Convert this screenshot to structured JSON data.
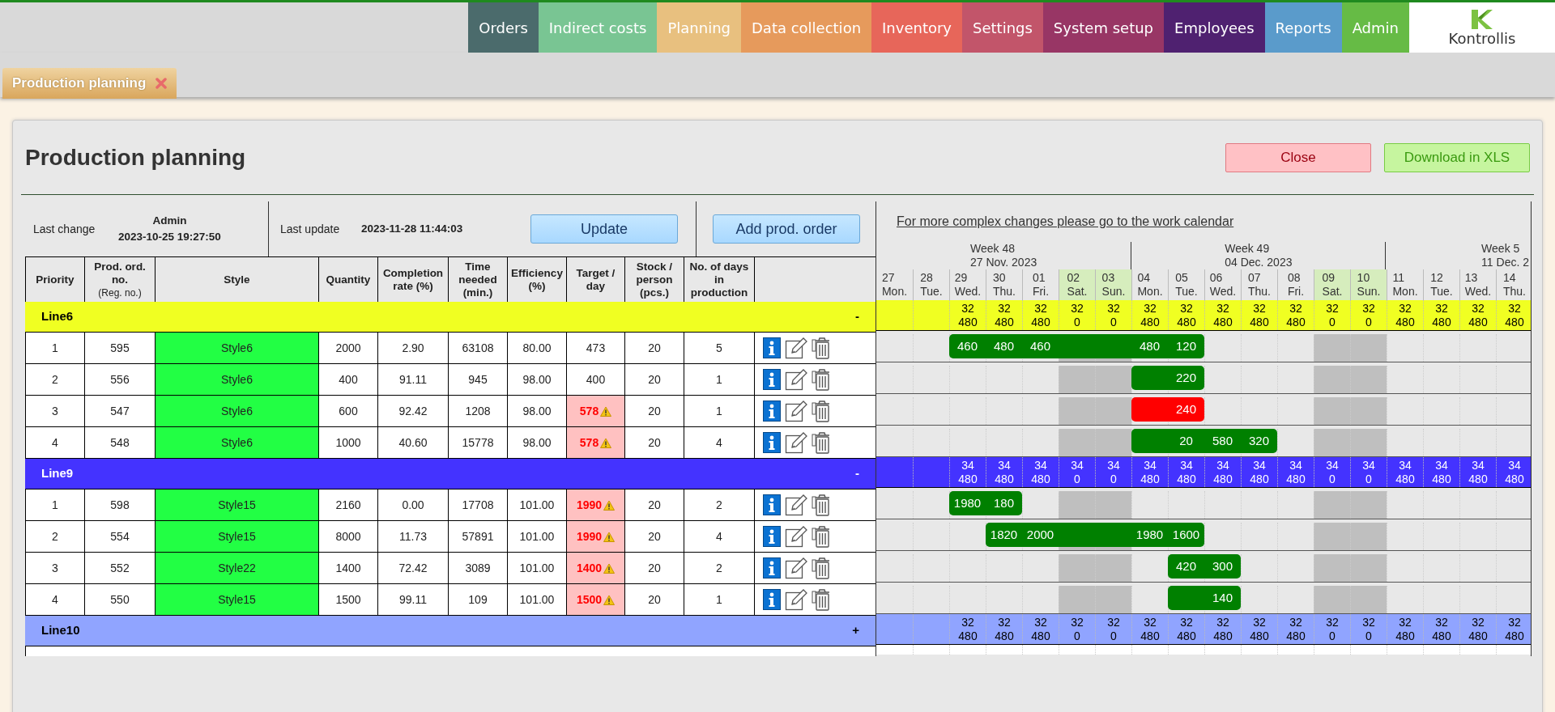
{
  "nav": [
    {
      "label": "Orders",
      "color": "#4b6b6c"
    },
    {
      "label": "Indirect costs",
      "color": "#79c593"
    },
    {
      "label": "Planning",
      "color": "#e8c07f"
    },
    {
      "label": "Data collection",
      "color": "#e69a5c"
    },
    {
      "label": "Inventory",
      "color": "#e7665a"
    },
    {
      "label": "Settings",
      "color": "#c2556a"
    },
    {
      "label": "System setup",
      "color": "#983665"
    },
    {
      "label": "Employees",
      "color": "#4f2170"
    },
    {
      "label": "Reports",
      "color": "#5a9bcb"
    },
    {
      "label": "Admin",
      "color": "#66bb45"
    }
  ],
  "logo": {
    "text": "Kontrollis"
  },
  "tabs": [
    {
      "label": "Production planning",
      "selected": true
    }
  ],
  "title": "Production planning",
  "buttons": [
    {
      "label": "Close",
      "kind": "danger"
    },
    {
      "label": "Download in XLS",
      "kind": "success"
    }
  ],
  "info": {
    "last_change_label": "Last change",
    "last_change_user": "Admin",
    "last_change_time": "2023-10-25 19:27:50",
    "last_update_label": "Last update",
    "last_update_time": "2023-11-28 11:44:03",
    "update_button": "Update",
    "add_button": "Add prod. order"
  },
  "calendar_link": "For more complex changes please go to the work calendar",
  "columns": [
    {
      "label": "Priority"
    },
    {
      "label": "Prod. ord. no.",
      "sub": "(Reg. no.)"
    },
    {
      "label": "Style"
    },
    {
      "label": "Quantity"
    },
    {
      "label": "Completion rate (%)"
    },
    {
      "label": "Time needed (min.)"
    },
    {
      "label": "Efficiency (%)"
    },
    {
      "label": "Target / day"
    },
    {
      "label": "Stock / person (pcs.)"
    },
    {
      "label": "No. of days in production"
    }
  ],
  "weeks": [
    {
      "label": "Week 48",
      "date": "27 Nov. 2023",
      "days": [
        {
          "num": "27",
          "name": "Mon.",
          "weekend": false
        },
        {
          "num": "28",
          "name": "Tue.",
          "weekend": false
        },
        {
          "num": "29",
          "name": "Wed.",
          "weekend": false
        },
        {
          "num": "30",
          "name": "Thu.",
          "weekend": false
        },
        {
          "num": "01",
          "name": "Fri.",
          "weekend": false
        },
        {
          "num": "02",
          "name": "Sat.",
          "weekend": true
        },
        {
          "num": "03",
          "name": "Sun.",
          "weekend": true
        }
      ]
    },
    {
      "label": "Week 49",
      "date": "04 Dec. 2023",
      "days": [
        {
          "num": "04",
          "name": "Mon.",
          "weekend": false
        },
        {
          "num": "05",
          "name": "Tue.",
          "weekend": false
        },
        {
          "num": "06",
          "name": "Wed.",
          "weekend": false
        },
        {
          "num": "07",
          "name": "Thu.",
          "weekend": false
        },
        {
          "num": "08",
          "name": "Fri.",
          "weekend": false
        },
        {
          "num": "09",
          "name": "Sat.",
          "weekend": true
        },
        {
          "num": "10",
          "name": "Sun.",
          "weekend": true
        }
      ]
    },
    {
      "label": "Week 5",
      "date": "11 Dec. 2",
      "days": [
        {
          "num": "11",
          "name": "Mon.",
          "weekend": false
        },
        {
          "num": "12",
          "name": "Tue.",
          "weekend": false
        },
        {
          "num": "13",
          "name": "Wed.",
          "weekend": false
        },
        {
          "num": "14",
          "name": "Thu.",
          "weekend": false
        }
      ]
    }
  ],
  "lines": [
    {
      "name": "Line6",
      "color": "#f0ff22",
      "toggle": "-",
      "capacity": [
        {
          "kind": "empty"
        },
        {
          "kind": "empty"
        },
        {
          "kind": "value",
          "workers": "32",
          "minutes": "480"
        },
        {
          "kind": "value",
          "workers": "32",
          "minutes": "480"
        },
        {
          "kind": "value",
          "workers": "32",
          "minutes": "480"
        },
        {
          "kind": "value",
          "workers": "32",
          "minutes": "0"
        },
        {
          "kind": "value",
          "workers": "32",
          "minutes": "0"
        },
        {
          "kind": "value",
          "workers": "32",
          "minutes": "480"
        },
        {
          "kind": "value",
          "workers": "32",
          "minutes": "480"
        },
        {
          "kind": "value",
          "workers": "32",
          "minutes": "480"
        },
        {
          "kind": "value",
          "workers": "32",
          "minutes": "480"
        },
        {
          "kind": "value",
          "workers": "32",
          "minutes": "480"
        },
        {
          "kind": "value",
          "workers": "32",
          "minutes": "0"
        },
        {
          "kind": "value",
          "workers": "32",
          "minutes": "0"
        },
        {
          "kind": "value",
          "workers": "32",
          "minutes": "480"
        },
        {
          "kind": "value",
          "workers": "32",
          "minutes": "480"
        },
        {
          "kind": "value",
          "workers": "32",
          "minutes": "480"
        },
        {
          "kind": "value",
          "workers": "32",
          "minutes": "480"
        }
      ],
      "orders": [
        {
          "priority": "1",
          "order_no": "595",
          "style": "Style6",
          "quantity": "2000",
          "completion": "2.90",
          "time_needed": "63108",
          "efficiency": "80.00",
          "target": "473",
          "target_warning": false,
          "stock": "20",
          "days": "5",
          "color": "#008000",
          "slots": [
            {
              "kind": "free"
            },
            {
              "kind": "free"
            },
            {
              "kind": "bar",
              "text": "460"
            },
            {
              "kind": "bar",
              "text": "480"
            },
            {
              "kind": "bar",
              "text": "460"
            },
            {
              "kind": "bar"
            },
            {
              "kind": "bar"
            },
            {
              "kind": "bar",
              "text": "480"
            },
            {
              "kind": "bar",
              "text": "120"
            },
            {
              "kind": "free"
            },
            {
              "kind": "free"
            },
            {
              "kind": "free"
            },
            {
              "kind": "free"
            },
            {
              "kind": "free"
            },
            {
              "kind": "free"
            },
            {
              "kind": "free"
            },
            {
              "kind": "free"
            },
            {
              "kind": "free"
            }
          ]
        },
        {
          "priority": "2",
          "order_no": "556",
          "style": "Style6",
          "quantity": "400",
          "completion": "91.11",
          "time_needed": "945",
          "efficiency": "98.00",
          "target": "400",
          "target_warning": false,
          "stock": "20",
          "days": "1",
          "color": "#008000",
          "slots": [
            {
              "kind": "free"
            },
            {
              "kind": "free"
            },
            {
              "kind": "free"
            },
            {
              "kind": "free"
            },
            {
              "kind": "free"
            },
            {
              "kind": "free"
            },
            {
              "kind": "free"
            },
            {
              "kind": "bar"
            },
            {
              "kind": "bar",
              "text": "220"
            },
            {
              "kind": "free"
            },
            {
              "kind": "free"
            },
            {
              "kind": "free"
            },
            {
              "kind": "free"
            },
            {
              "kind": "free"
            },
            {
              "kind": "free"
            },
            {
              "kind": "free"
            },
            {
              "kind": "free"
            },
            {
              "kind": "free"
            }
          ]
        },
        {
          "priority": "3",
          "order_no": "547",
          "style": "Style6",
          "quantity": "600",
          "completion": "92.42",
          "time_needed": "1208",
          "efficiency": "98.00",
          "target": "578",
          "target_warning": true,
          "stock": "20",
          "days": "1",
          "color": "#ff0000",
          "slots": [
            {
              "kind": "free"
            },
            {
              "kind": "free"
            },
            {
              "kind": "free"
            },
            {
              "kind": "free"
            },
            {
              "kind": "free"
            },
            {
              "kind": "free"
            },
            {
              "kind": "free"
            },
            {
              "kind": "bar"
            },
            {
              "kind": "bar",
              "text": "240"
            },
            {
              "kind": "free"
            },
            {
              "kind": "free"
            },
            {
              "kind": "free"
            },
            {
              "kind": "free"
            },
            {
              "kind": "free"
            },
            {
              "kind": "free"
            },
            {
              "kind": "free"
            },
            {
              "kind": "free"
            },
            {
              "kind": "free"
            }
          ]
        },
        {
          "priority": "4",
          "order_no": "548",
          "style": "Style6",
          "quantity": "1000",
          "completion": "40.60",
          "time_needed": "15778",
          "efficiency": "98.00",
          "target": "578",
          "target_warning": true,
          "stock": "20",
          "days": "4",
          "color": "#008000",
          "slots": [
            {
              "kind": "free"
            },
            {
              "kind": "free"
            },
            {
              "kind": "free"
            },
            {
              "kind": "free"
            },
            {
              "kind": "free"
            },
            {
              "kind": "free"
            },
            {
              "kind": "free"
            },
            {
              "kind": "bar"
            },
            {
              "kind": "bar",
              "text": "20"
            },
            {
              "kind": "bar",
              "text": "580"
            },
            {
              "kind": "bar",
              "text": "320"
            },
            {
              "kind": "free"
            },
            {
              "kind": "free"
            },
            {
              "kind": "free"
            },
            {
              "kind": "free"
            },
            {
              "kind": "free"
            },
            {
              "kind": "free"
            },
            {
              "kind": "free"
            }
          ]
        }
      ]
    },
    {
      "name": "Line9",
      "color": "#4433ff",
      "toggle": "-",
      "capacity": [
        {
          "kind": "empty"
        },
        {
          "kind": "empty"
        },
        {
          "kind": "value",
          "workers": "34",
          "minutes": "480"
        },
        {
          "kind": "value",
          "workers": "34",
          "minutes": "480"
        },
        {
          "kind": "value",
          "workers": "34",
          "minutes": "480"
        },
        {
          "kind": "value",
          "workers": "34",
          "minutes": "0"
        },
        {
          "kind": "value",
          "workers": "34",
          "minutes": "0"
        },
        {
          "kind": "value",
          "workers": "34",
          "minutes": "480"
        },
        {
          "kind": "value",
          "workers": "34",
          "minutes": "480"
        },
        {
          "kind": "value",
          "workers": "34",
          "minutes": "480"
        },
        {
          "kind": "value",
          "workers": "34",
          "minutes": "480"
        },
        {
          "kind": "value",
          "workers": "34",
          "minutes": "480"
        },
        {
          "kind": "value",
          "workers": "34",
          "minutes": "0"
        },
        {
          "kind": "value",
          "workers": "34",
          "minutes": "0"
        },
        {
          "kind": "value",
          "workers": "34",
          "minutes": "480"
        },
        {
          "kind": "value",
          "workers": "34",
          "minutes": "480"
        },
        {
          "kind": "value",
          "workers": "34",
          "minutes": "480"
        },
        {
          "kind": "value",
          "workers": "34",
          "minutes": "480"
        }
      ],
      "orders": [
        {
          "priority": "1",
          "order_no": "598",
          "style": "Style15",
          "quantity": "2160",
          "completion": "0.00",
          "time_needed": "17708",
          "efficiency": "101.00",
          "target": "1990",
          "target_warning": true,
          "stock": "20",
          "days": "2",
          "color": "#008000",
          "slots": [
            {
              "kind": "free"
            },
            {
              "kind": "free"
            },
            {
              "kind": "bar",
              "text": "1980"
            },
            {
              "kind": "bar",
              "text": "180"
            },
            {
              "kind": "free"
            },
            {
              "kind": "free"
            },
            {
              "kind": "free"
            },
            {
              "kind": "free"
            },
            {
              "kind": "free"
            },
            {
              "kind": "free"
            },
            {
              "kind": "free"
            },
            {
              "kind": "free"
            },
            {
              "kind": "free"
            },
            {
              "kind": "free"
            },
            {
              "kind": "free"
            },
            {
              "kind": "free"
            },
            {
              "kind": "free"
            },
            {
              "kind": "free"
            }
          ]
        },
        {
          "priority": "2",
          "order_no": "554",
          "style": "Style15",
          "quantity": "8000",
          "completion": "11.73",
          "time_needed": "57891",
          "efficiency": "101.00",
          "target": "1990",
          "target_warning": true,
          "stock": "20",
          "days": "4",
          "color": "#008000",
          "slots": [
            {
              "kind": "free"
            },
            {
              "kind": "free"
            },
            {
              "kind": "free"
            },
            {
              "kind": "bar",
              "text": "1820"
            },
            {
              "kind": "bar",
              "text": "2000"
            },
            {
              "kind": "bar"
            },
            {
              "kind": "bar"
            },
            {
              "kind": "bar",
              "text": "1980"
            },
            {
              "kind": "bar",
              "text": "1600"
            },
            {
              "kind": "free"
            },
            {
              "kind": "free"
            },
            {
              "kind": "free"
            },
            {
              "kind": "free"
            },
            {
              "kind": "free"
            },
            {
              "kind": "free"
            },
            {
              "kind": "free"
            },
            {
              "kind": "free"
            },
            {
              "kind": "free"
            }
          ]
        },
        {
          "priority": "3",
          "order_no": "552",
          "style": "Style22",
          "quantity": "1400",
          "completion": "72.42",
          "time_needed": "3089",
          "efficiency": "101.00",
          "target": "1400",
          "target_warning": true,
          "stock": "20",
          "days": "2",
          "color": "#008000",
          "slots": [
            {
              "kind": "free"
            },
            {
              "kind": "free"
            },
            {
              "kind": "free"
            },
            {
              "kind": "free"
            },
            {
              "kind": "free"
            },
            {
              "kind": "free"
            },
            {
              "kind": "free"
            },
            {
              "kind": "free"
            },
            {
              "kind": "bar",
              "text": "420"
            },
            {
              "kind": "bar",
              "text": "300"
            },
            {
              "kind": "free"
            },
            {
              "kind": "free"
            },
            {
              "kind": "free"
            },
            {
              "kind": "free"
            },
            {
              "kind": "free"
            },
            {
              "kind": "free"
            },
            {
              "kind": "free"
            },
            {
              "kind": "free"
            }
          ]
        },
        {
          "priority": "4",
          "order_no": "550",
          "style": "Style15",
          "quantity": "1500",
          "completion": "99.11",
          "time_needed": "109",
          "efficiency": "101.00",
          "target": "1500",
          "target_warning": true,
          "stock": "20",
          "days": "1",
          "color": "#008000",
          "slots": [
            {
              "kind": "free"
            },
            {
              "kind": "free"
            },
            {
              "kind": "free"
            },
            {
              "kind": "free"
            },
            {
              "kind": "free"
            },
            {
              "kind": "free"
            },
            {
              "kind": "free"
            },
            {
              "kind": "free"
            },
            {
              "kind": "bar"
            },
            {
              "kind": "bar",
              "text": "140"
            },
            {
              "kind": "free"
            },
            {
              "kind": "free"
            },
            {
              "kind": "free"
            },
            {
              "kind": "free"
            },
            {
              "kind": "free"
            },
            {
              "kind": "free"
            },
            {
              "kind": "free"
            },
            {
              "kind": "free"
            }
          ]
        }
      ]
    },
    {
      "name": "Line10",
      "color": "#90a4ff",
      "toggle": "+",
      "capacity": [
        {
          "kind": "empty"
        },
        {
          "kind": "empty"
        },
        {
          "kind": "value",
          "workers": "32",
          "minutes": "480"
        },
        {
          "kind": "value",
          "workers": "32",
          "minutes": "480"
        },
        {
          "kind": "value",
          "workers": "32",
          "minutes": "480"
        },
        {
          "kind": "value",
          "workers": "32",
          "minutes": "0"
        },
        {
          "kind": "value",
          "workers": "32",
          "minutes": "0"
        },
        {
          "kind": "value",
          "workers": "32",
          "minutes": "480"
        },
        {
          "kind": "value",
          "workers": "32",
          "minutes": "480"
        },
        {
          "kind": "value",
          "workers": "32",
          "minutes": "480"
        },
        {
          "kind": "value",
          "workers": "32",
          "minutes": "480"
        },
        {
          "kind": "value",
          "workers": "32",
          "minutes": "480"
        },
        {
          "kind": "value",
          "workers": "32",
          "minutes": "0"
        },
        {
          "kind": "value",
          "workers": "32",
          "minutes": "0"
        },
        {
          "kind": "value",
          "workers": "32",
          "minutes": "480"
        },
        {
          "kind": "value",
          "workers": "32",
          "minutes": "480"
        },
        {
          "kind": "value",
          "workers": "32",
          "minutes": "480"
        },
        {
          "kind": "value",
          "workers": "32",
          "minutes": "480"
        }
      ]
    }
  ]
}
